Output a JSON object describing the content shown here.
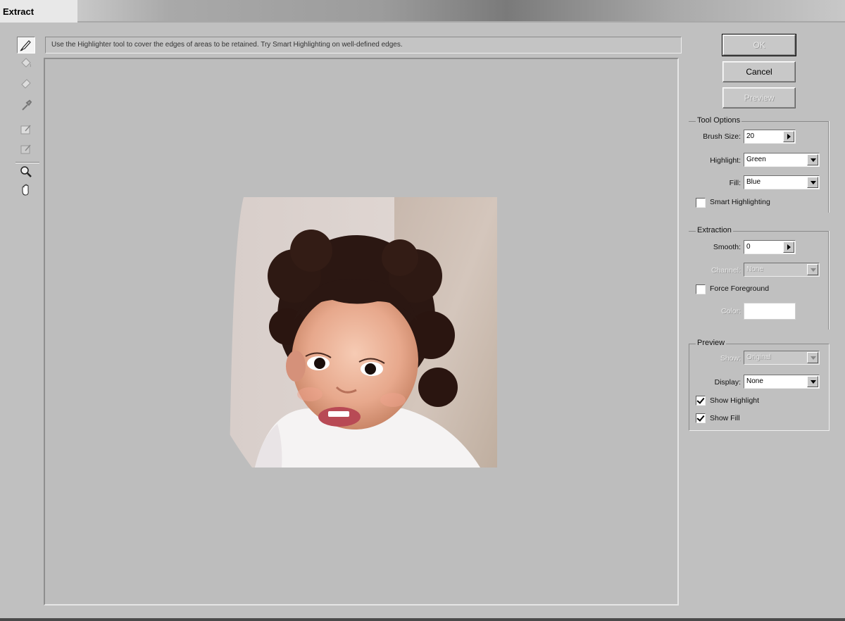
{
  "window": {
    "title": "Extract"
  },
  "hint": "Use the Highlighter tool to cover the edges of areas to be retained. Try Smart Highlighting on well-defined edges.",
  "tools": [
    {
      "name": "edge-highlighter-icon",
      "active": true
    },
    {
      "name": "fill-icon",
      "active": false
    },
    {
      "name": "eraser-icon",
      "active": false
    },
    {
      "name": "eyedropper-icon",
      "active": false
    },
    {
      "name": "cleanup-icon",
      "active": false
    },
    {
      "name": "edge-touchup-icon",
      "active": false
    },
    {
      "name": "zoom-icon",
      "active": false
    },
    {
      "name": "hand-icon",
      "active": false
    }
  ],
  "buttons": {
    "ok": "OK",
    "cancel": "Cancel",
    "preview": "Preview"
  },
  "tool_options": {
    "title": "Tool Options",
    "brush_size_label": "Brush Size:",
    "brush_size_value": "20",
    "highlight_label": "Highlight:",
    "highlight_value": "Green",
    "fill_label": "Fill:",
    "fill_value": "Blue",
    "smart_label": "Smart Highlighting",
    "smart_checked": false
  },
  "extraction": {
    "title": "Extraction",
    "smooth_label": "Smooth:",
    "smooth_value": "0",
    "channel_label": "Channel:",
    "channel_value": "None",
    "force_label": "Force Foreground",
    "force_checked": false,
    "color_label": "Color:"
  },
  "preview": {
    "title": "Preview",
    "show_label": "Show:",
    "show_value": "Original",
    "display_label": "Display:",
    "display_value": "None",
    "show_highlight_label": "Show Highlight",
    "show_highlight_checked": true,
    "show_fill_label": "Show Fill",
    "show_fill_checked": true
  }
}
